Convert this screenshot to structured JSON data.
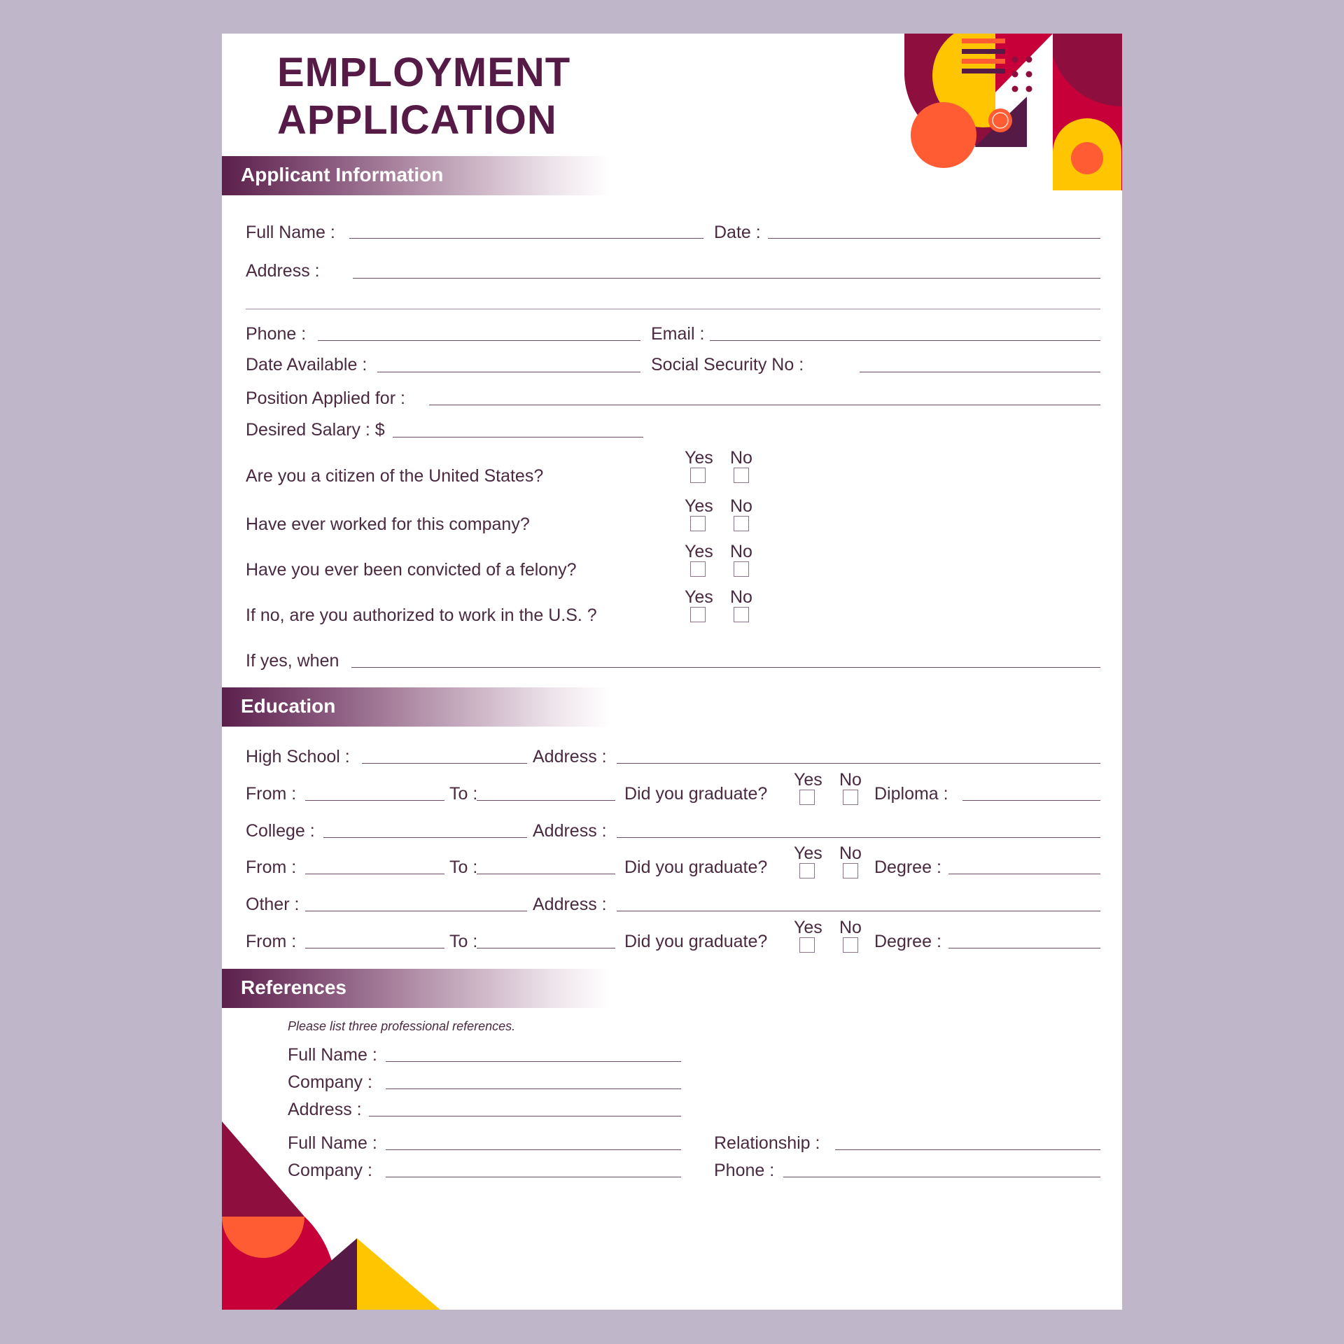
{
  "title": {
    "line1": "EMPLOYMENT",
    "line2": "APPLICATION"
  },
  "colors": {
    "primary": "#561a47",
    "crimson": "#c8003a",
    "maroon": "#8e0f3e",
    "orange": "#ff5c33",
    "yellow": "#ffc500",
    "background": "#bfb6c9"
  },
  "sections": {
    "applicant": {
      "heading": "Applicant Information",
      "fields": {
        "full_name": "Full Name :",
        "date": "Date :",
        "address": "Address :",
        "phone": "Phone :",
        "email": "Email :",
        "date_available": "Date Available :",
        "ssn": "Social Security No :",
        "position": "Position Applied for :",
        "salary": "Desired Salary : $"
      },
      "questions": [
        {
          "text": "Are you a citizen of the United States?",
          "yes": "Yes",
          "no": "No"
        },
        {
          "text": "Have ever worked for this company?",
          "yes": "Yes",
          "no": "No"
        },
        {
          "text": "Have you ever been convicted of a felony?",
          "yes": "Yes",
          "no": "No"
        },
        {
          "text": "If no, are you authorized to work in the U.S. ?",
          "yes": "Yes",
          "no": "No"
        }
      ],
      "if_yes": "If yes, when"
    },
    "education": {
      "heading": "Education",
      "rows": [
        {
          "school": "High School :",
          "address": "Address :",
          "from": "From :",
          "to": "To :",
          "graduate": "Did you graduate?",
          "yes": "Yes",
          "no": "No",
          "credential": "Diploma :"
        },
        {
          "school": "College :",
          "address": "Address :",
          "from": "From :",
          "to": "To :",
          "graduate": "Did you graduate?",
          "yes": "Yes",
          "no": "No",
          "credential": "Degree :"
        },
        {
          "school": "Other :",
          "address": "Address :",
          "from": "From :",
          "to": "To :",
          "graduate": "Did you graduate?",
          "yes": "Yes",
          "no": "No",
          "credential": "Degree :"
        }
      ]
    },
    "references": {
      "heading": "References",
      "note": "Please list three professional references.",
      "ref1": {
        "full_name": "Full Name :",
        "company": "Company :",
        "address": "Address :"
      },
      "ref2": {
        "full_name": "Full Name :",
        "company": "Company :",
        "relationship": "Relationship :",
        "phone": "Phone :"
      }
    }
  }
}
